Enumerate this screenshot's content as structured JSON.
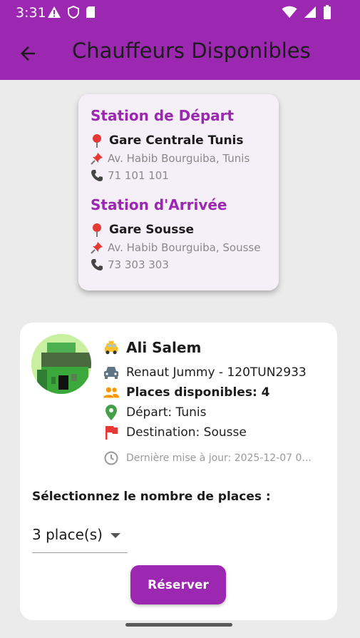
{
  "status_bar": {
    "time": "3:31"
  },
  "app_bar": {
    "title": "Chauffeurs Disponibles"
  },
  "departure": {
    "heading": "Station de Départ",
    "name": "Gare Centrale Tunis",
    "address": "Av. Habib Bourguiba, Tunis",
    "phone": "71 101 101"
  },
  "arrival": {
    "heading": "Station d'Arrivée",
    "name": "Gare Sousse",
    "address": "Av. Habib Bourguiba, Sousse",
    "phone": "73 303 303"
  },
  "driver": {
    "name": "Ali Salem",
    "vehicle": "Renaut Jummy - 120TUN2933",
    "seats": "Places disponibles: 4",
    "depart": "Départ: Tunis",
    "destination": "Destination: Sousse",
    "updated": "Dernière mise à jour: 2025-12-07 0..."
  },
  "booking": {
    "select_label": "Sélectionnez le nombre de places :",
    "selected_value": "3 place(s)",
    "reserve_label": "Réserver"
  },
  "colors": {
    "primary": "#9c27b0",
    "background": "#ebebeb",
    "card": "#ffffff",
    "station_card": "#f5eff7"
  }
}
